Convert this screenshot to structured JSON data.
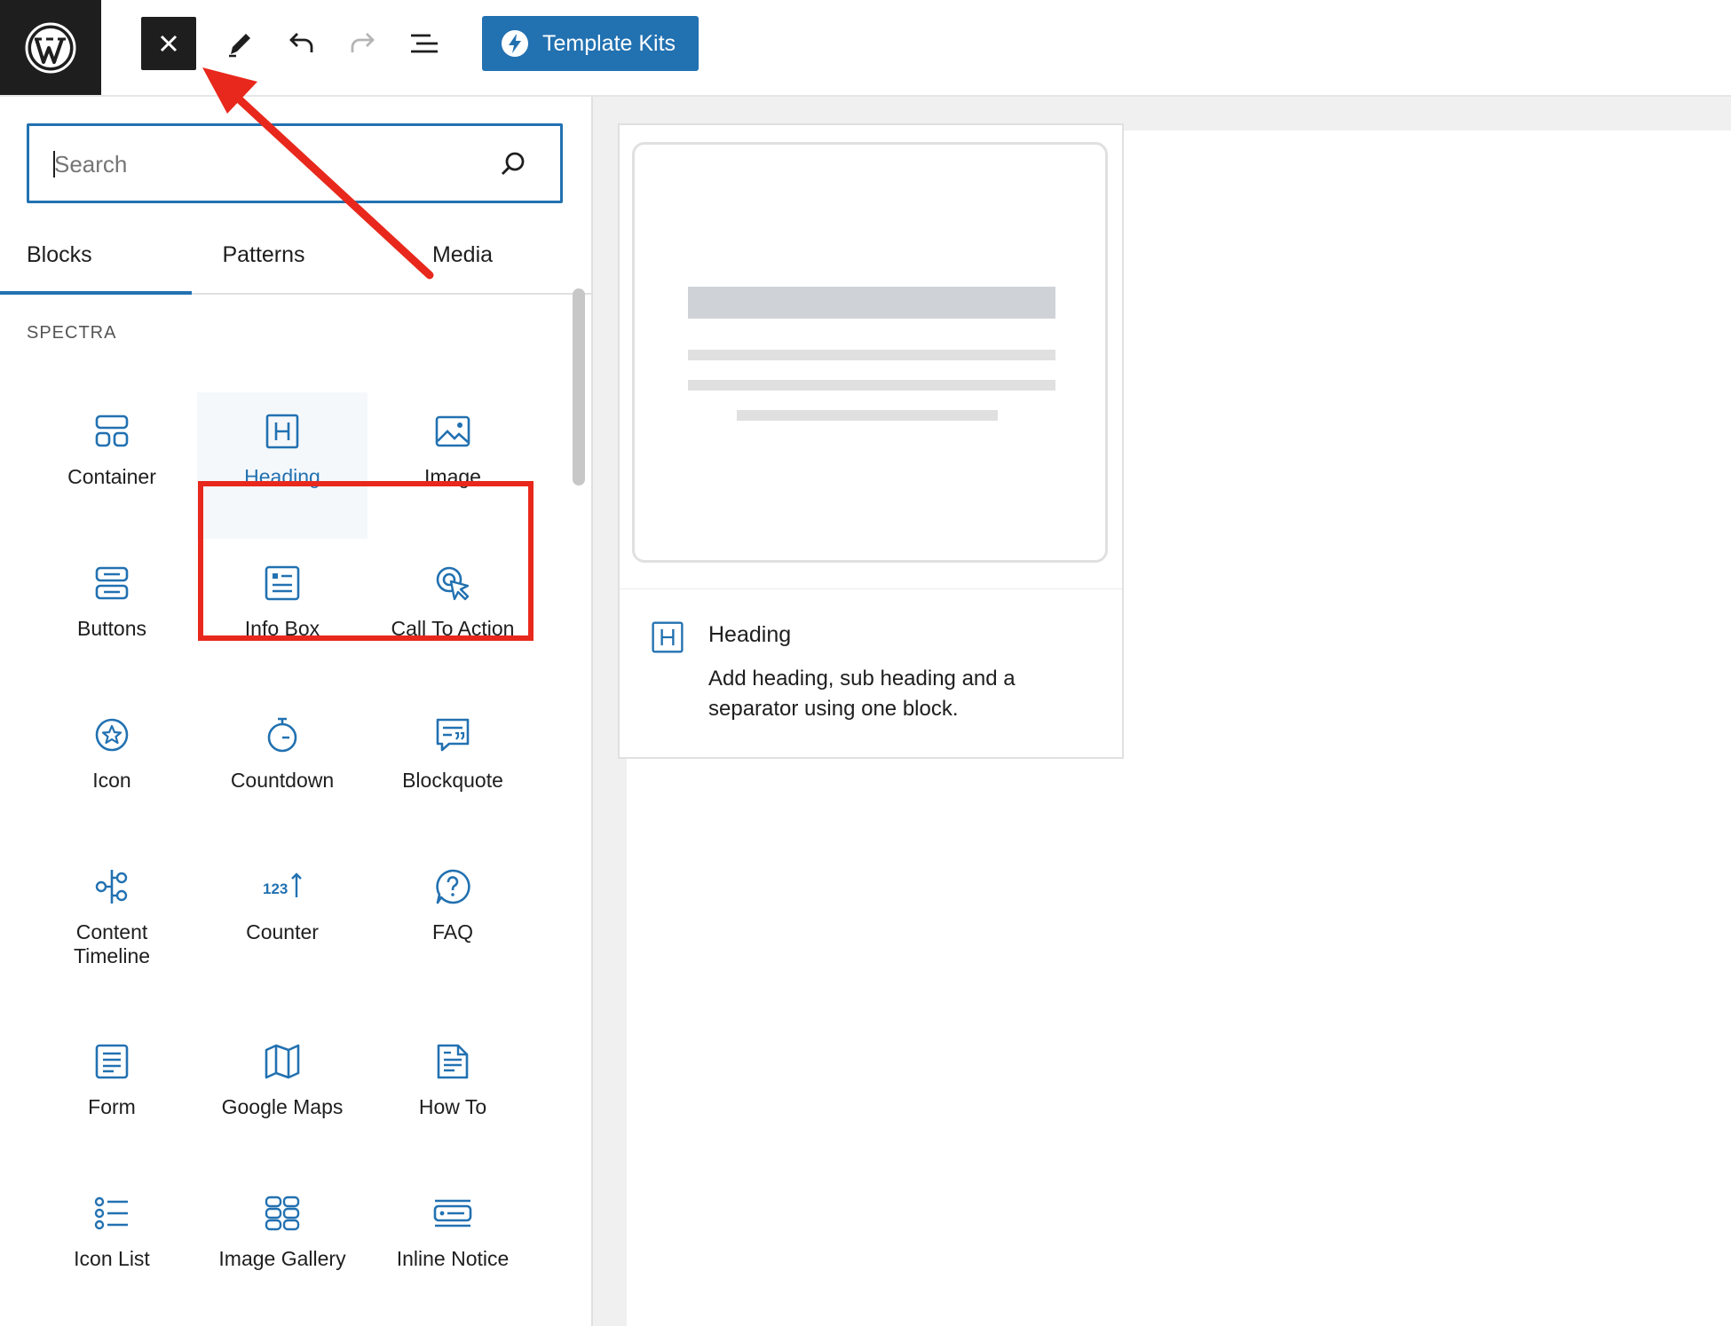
{
  "toolbar": {
    "close_label": "×",
    "template_kits_label": "Template Kits",
    "icons": [
      "wordpress-logo",
      "close-icon",
      "pencil-icon",
      "undo-icon",
      "redo-icon",
      "document-outline-icon",
      "spectra-bolt-icon"
    ]
  },
  "inserter": {
    "search_placeholder": "Search",
    "tabs": [
      "Blocks",
      "Patterns",
      "Media"
    ],
    "active_tab": "Blocks",
    "category": "SPECTRA",
    "blocks": [
      {
        "label": "Container",
        "icon": "container-icon"
      },
      {
        "label": "Heading",
        "icon": "heading-icon",
        "selected": true
      },
      {
        "label": "Image",
        "icon": "image-icon"
      },
      {
        "label": "Buttons",
        "icon": "buttons-icon"
      },
      {
        "label": "Info Box",
        "icon": "info-box-icon"
      },
      {
        "label": "Call To Action",
        "icon": "call-to-action-icon"
      },
      {
        "label": "Icon",
        "icon": "star-circle-icon"
      },
      {
        "label": "Countdown",
        "icon": "stopwatch-icon"
      },
      {
        "label": "Blockquote",
        "icon": "quote-icon"
      },
      {
        "label": "Content\nTimeline",
        "icon": "timeline-icon"
      },
      {
        "label": "Counter",
        "icon": "counter-icon"
      },
      {
        "label": "FAQ",
        "icon": "question-icon"
      },
      {
        "label": "Form",
        "icon": "form-icon"
      },
      {
        "label": "Google Maps",
        "icon": "map-icon"
      },
      {
        "label": "How To",
        "icon": "how-to-icon"
      },
      {
        "label": "Icon List",
        "icon": "list-icon"
      },
      {
        "label": "Image Gallery",
        "icon": "gallery-icon"
      },
      {
        "label": "Inline Notice",
        "icon": "notice-icon"
      }
    ]
  },
  "preview": {
    "title": "Heading",
    "description": "Add heading, sub heading and a separator using one block.",
    "icon": "heading-icon"
  },
  "colors": {
    "accent": "#2271b1",
    "annotation": "#e8281c",
    "dark": "#1e1e1e"
  }
}
